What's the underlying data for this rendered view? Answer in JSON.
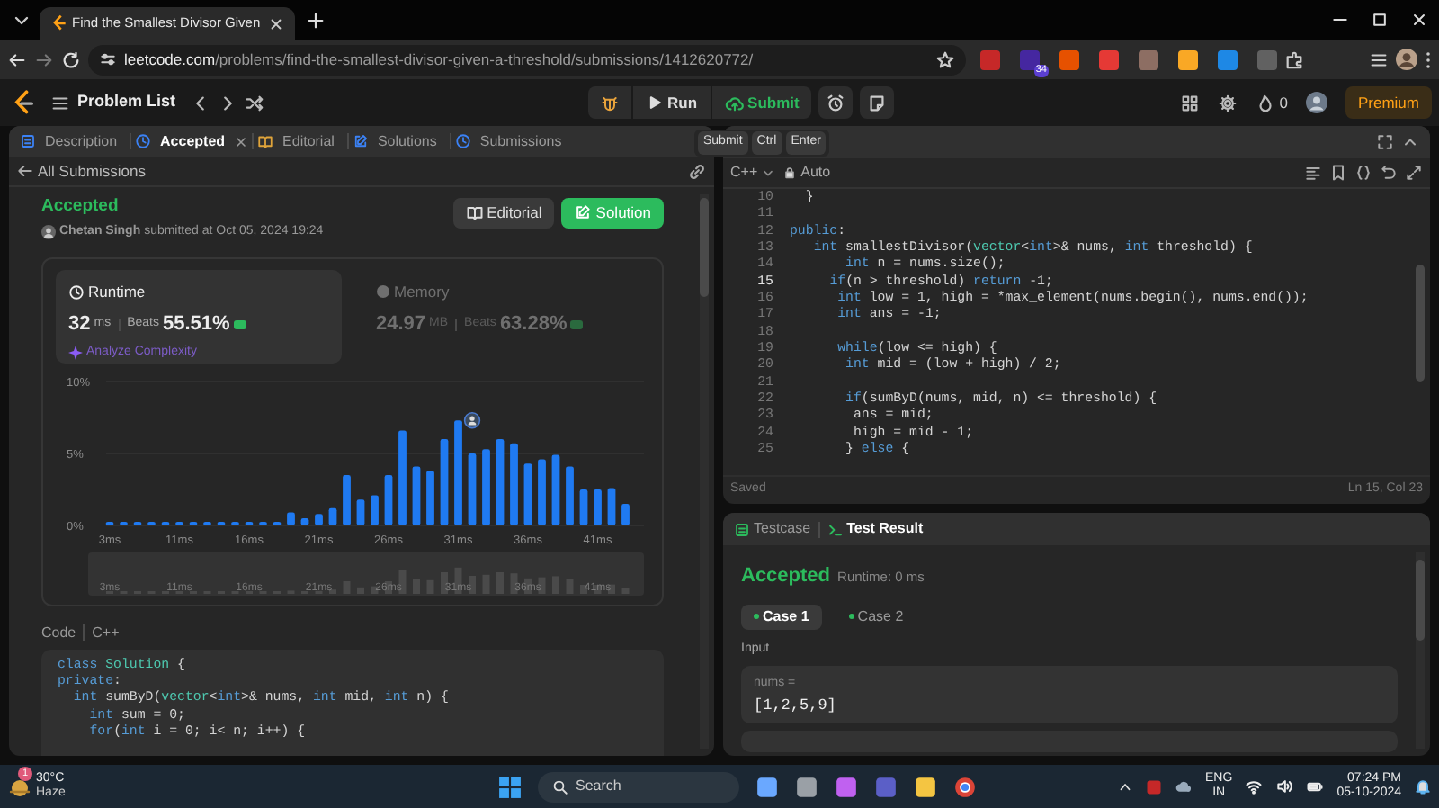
{
  "browser": {
    "tab_title": "Find the Smallest Divisor Given",
    "url": "leetcode.com/problems/find-the-smallest-divisor-given-a-threshold/submissions/1412620772/",
    "extensions": [
      {
        "color": "#c62828"
      },
      {
        "color": "#4527a0",
        "badge": "34"
      },
      {
        "color": "#e65100"
      },
      {
        "color": "#e53935"
      },
      {
        "color": "#8d6e63"
      },
      {
        "color": "#f9a825"
      },
      {
        "color": "#1e88e5"
      },
      {
        "color": "#616161"
      }
    ]
  },
  "nav": {
    "title": "Problem List",
    "run": "Run",
    "submit": "Submit",
    "streak": "0",
    "premium": "Premium"
  },
  "left_tabs": [
    {
      "label": "Description",
      "selected": false,
      "closable": false
    },
    {
      "label": "Accepted",
      "selected": true,
      "closable": true
    },
    {
      "label": "Editorial",
      "selected": false,
      "closable": false
    },
    {
      "label": "Solutions",
      "selected": false,
      "closable": false
    },
    {
      "label": "Submissions",
      "selected": false,
      "closable": false
    }
  ],
  "submission": {
    "back": "All Submissions",
    "status": "Accepted",
    "byline": "**Chetan Singh** submitted at Oct 05, 2024 19:24",
    "editorial_button": "Editorial",
    "solution_button": "Solution"
  },
  "stats": [
    {
      "label": "Runtime",
      "value": "32",
      "unit": "ms",
      "beats_label": "Beats",
      "beats": "55.51%",
      "selected": true,
      "link": "Analyze Complexity"
    },
    {
      "label": "Memory",
      "value": "24.97",
      "unit": "MB",
      "beats_label": "Beats",
      "beats": "63.28%",
      "selected": false
    }
  ],
  "chart_data": {
    "type": "bar",
    "categories": [
      "3ms",
      null,
      null,
      null,
      null,
      "11ms",
      null,
      null,
      null,
      null,
      "16ms",
      null,
      null,
      null,
      null,
      "21ms",
      null,
      null,
      null,
      null,
      "26ms",
      null,
      null,
      null,
      null,
      "31ms",
      null,
      null,
      null,
      null,
      "36ms",
      null,
      null,
      null,
      null,
      "41ms",
      null,
      null
    ],
    "values": [
      0.2,
      0.2,
      0.2,
      0.2,
      0.2,
      0.2,
      0.2,
      0.2,
      0.2,
      0.2,
      0.2,
      0.2,
      0.2,
      0.9,
      0.5,
      0.8,
      1.2,
      3.5,
      1.8,
      2.1,
      3.5,
      6.6,
      4.1,
      3.8,
      6.0,
      7.3,
      5.0,
      5.3,
      6.0,
      5.7,
      4.3,
      4.6,
      4.9,
      4.1,
      2.5,
      2.5,
      2.6,
      1.5
    ],
    "ylim": [
      0,
      10
    ],
    "yticks": [
      {
        "value": 0,
        "label": "0%"
      },
      {
        "value": 5,
        "label": "5%"
      },
      {
        "value": 10,
        "label": "10%"
      }
    ]
  },
  "navigator_labels": [
    "3ms",
    "11ms",
    "16ms",
    "21ms",
    "26ms",
    "31ms",
    "36ms",
    "41ms"
  ],
  "code_section": {
    "label": "Code",
    "language": "C++",
    "lines": [
      "class Solution {",
      "private:",
      "  int sumByD(vector<int>& nums, int mid, int n) {",
      "    int sum = 0;",
      "    for(int i = 0; i< n; i++) {"
    ]
  },
  "right_hint": [
    "Submit",
    "Ctrl",
    "Enter"
  ],
  "editor": {
    "language": "C++",
    "mode": "Auto",
    "status": "Saved",
    "cursor": "Ln 15, Col 23",
    "lines": [
      {
        "number": "10",
        "text": "  }",
        "current": false
      },
      {
        "number": "11",
        "current": false
      },
      {
        "number": "12",
        "text": "public:",
        "current": false
      },
      {
        "number": "13",
        "text": "   int smallestDivisor(vector<int>& nums, int threshold) {",
        "current": false
      },
      {
        "number": "14",
        "text": "       int n = nums.size();",
        "current": false
      },
      {
        "number": "15",
        "text": "     if(n > threshold) return -1;",
        "current": true
      },
      {
        "number": "16",
        "text": "      int low = 1, high = *max_element(nums.begin(), nums.end());",
        "current": false
      },
      {
        "number": "17",
        "text": "      int ans = -1;",
        "current": false
      },
      {
        "number": "18",
        "current": false
      },
      {
        "number": "19",
        "text": "      while(low <= high) {",
        "current": false
      },
      {
        "number": "20",
        "text": "       int mid = (low + high) / 2;",
        "current": false
      },
      {
        "number": "21",
        "current": false
      },
      {
        "number": "22",
        "text": "       if(sumByD(nums, mid, n) <= threshold) {",
        "current": false
      },
      {
        "number": "23",
        "text": "        ans = mid;",
        "current": false
      },
      {
        "number": "24",
        "text": "        high = mid - 1;",
        "current": false
      },
      {
        "number": "25",
        "text": "       } else {",
        "current": false
      }
    ]
  },
  "result": {
    "tabs": [
      {
        "label": "Testcase",
        "selected": false
      },
      {
        "label": "Test Result",
        "selected": true
      }
    ],
    "status": "Accepted",
    "runtime": "Runtime: 0 ms",
    "cases": [
      {
        "label": "Case 1",
        "selected": true
      },
      {
        "label": "Case 2",
        "selected": false
      }
    ],
    "input_label": "Input",
    "inputs": [
      {
        "name": "nums =",
        "value": "[1,2,5,9]"
      }
    ]
  },
  "taskbar": {
    "temp": "30°C",
    "weather": "Haze",
    "weather_badge": "1",
    "search_placeholder": "Search",
    "lang": "ENG",
    "region": "IN",
    "time": "07:24 PM",
    "date": "05-10-2024"
  }
}
